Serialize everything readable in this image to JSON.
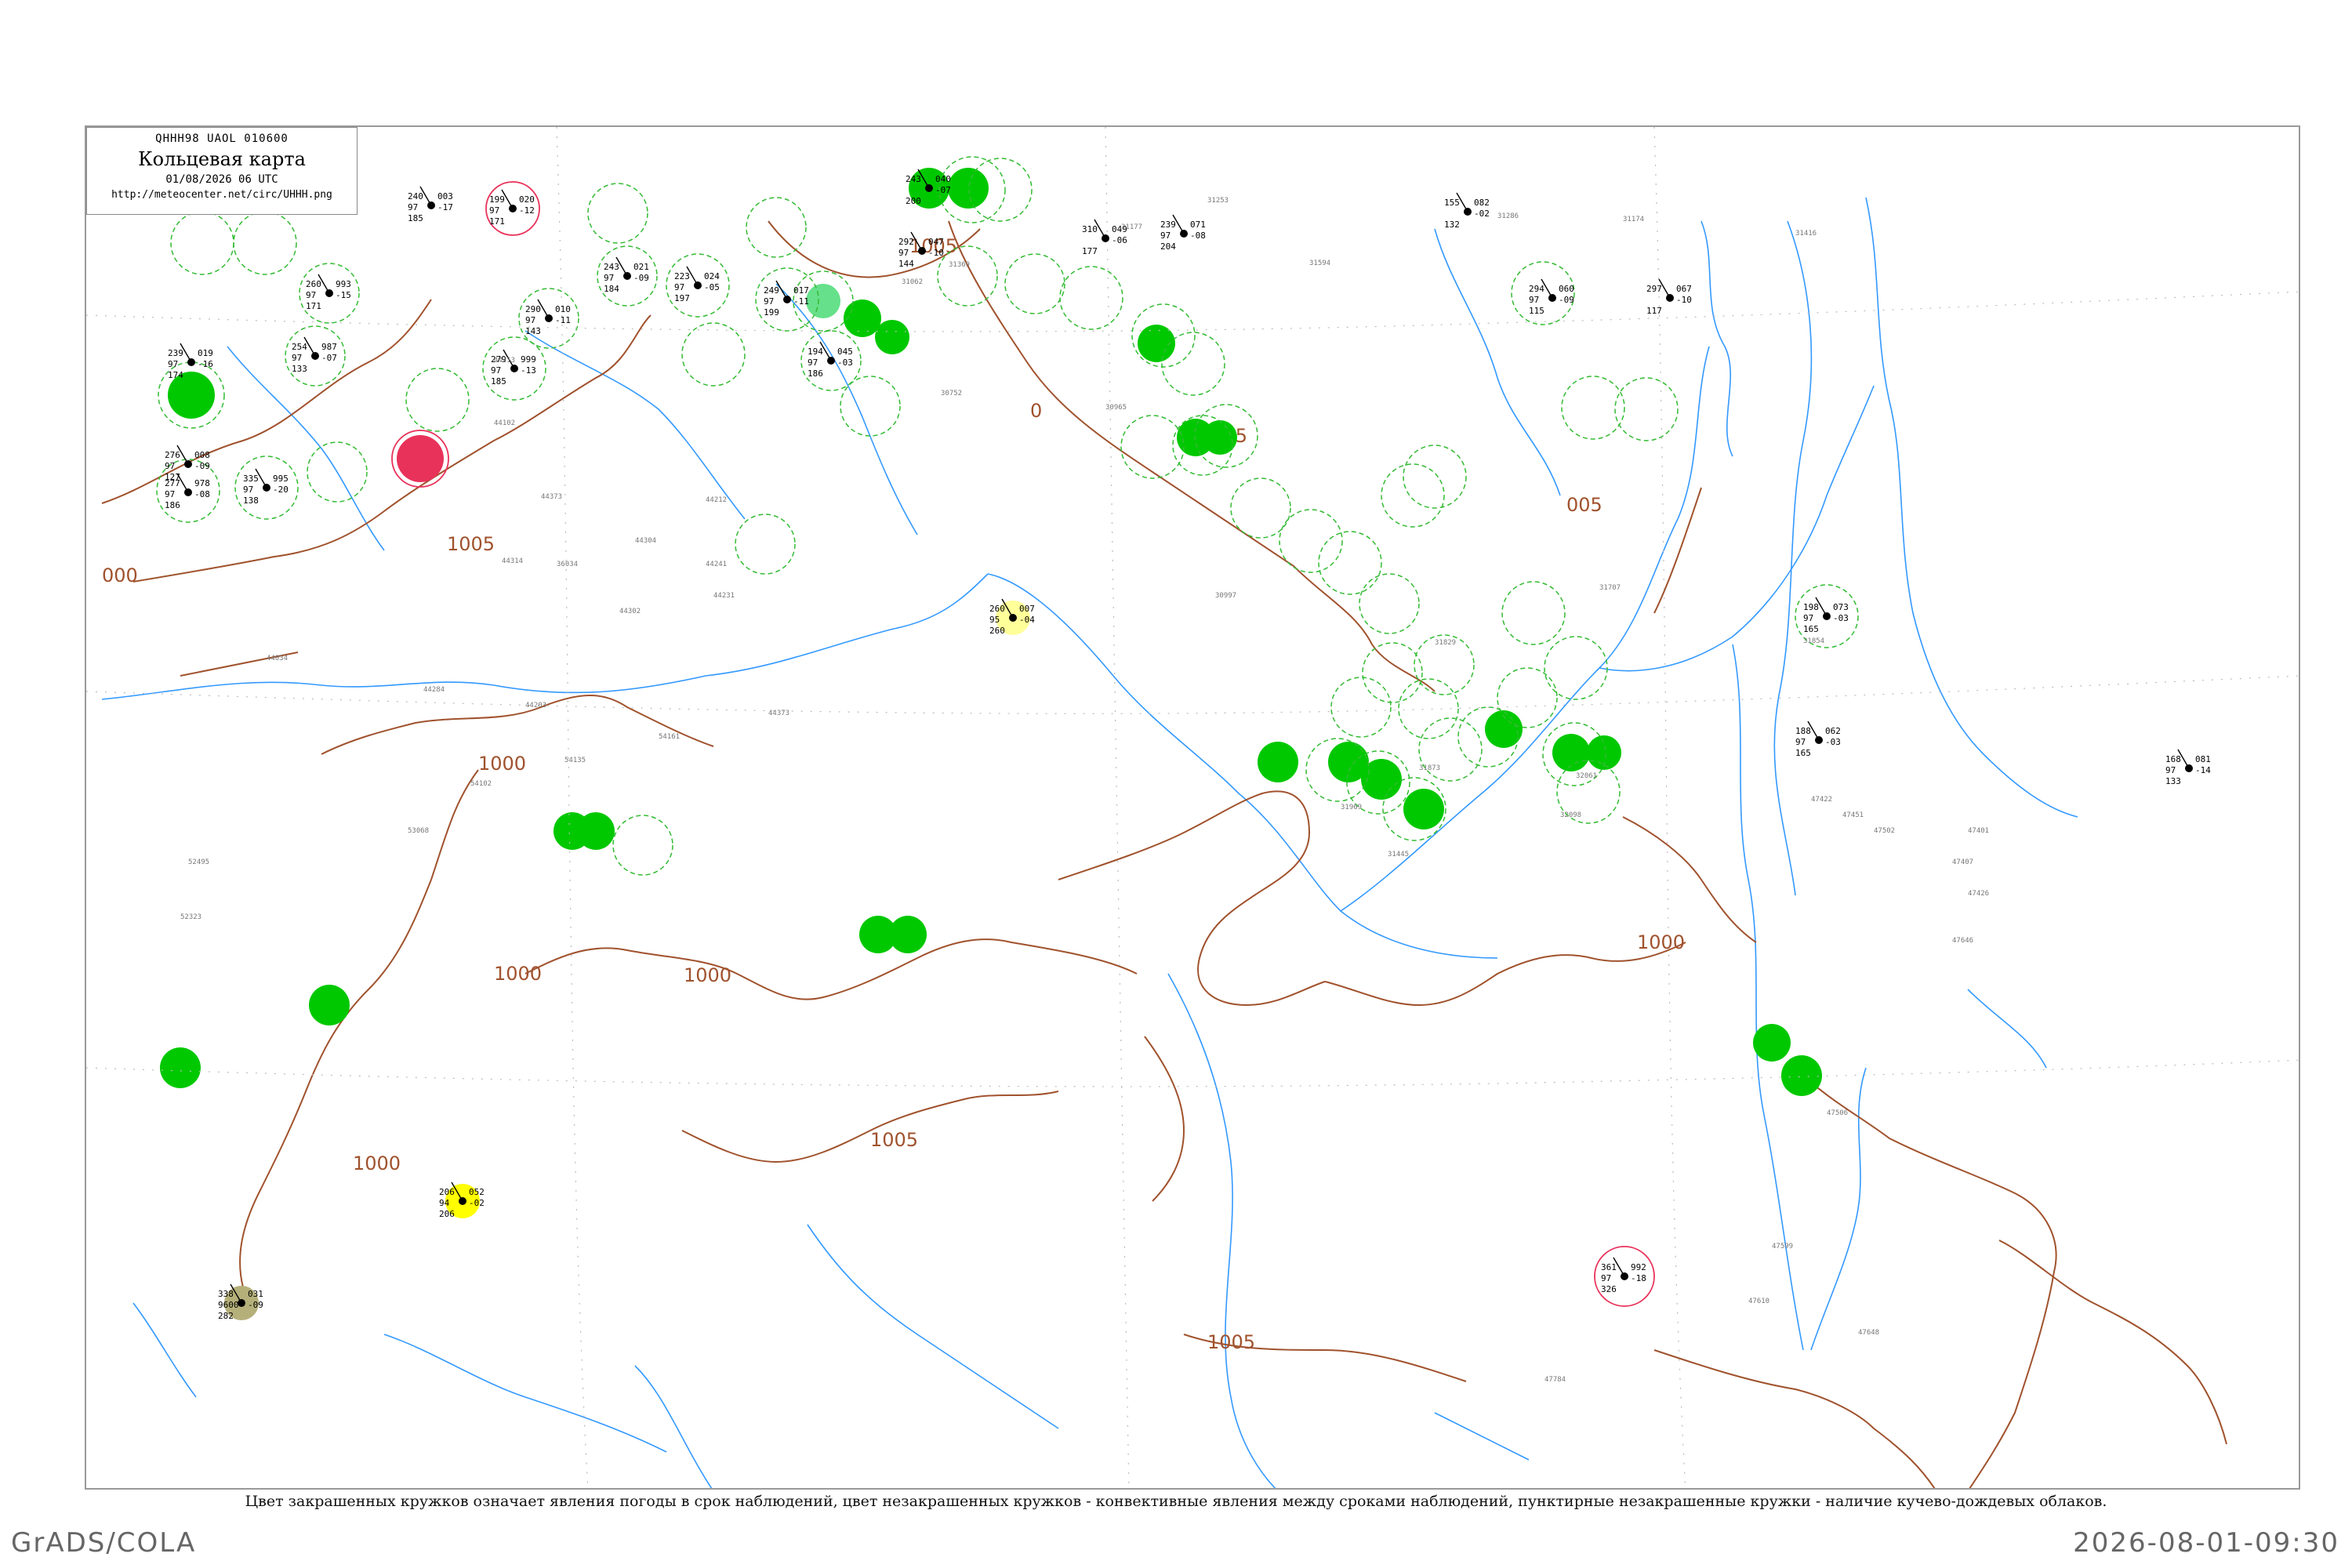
{
  "title_box": {
    "code_line": "QHHH98  UAOL  010600",
    "title": "Кольцевая карта",
    "datetime": "01/08/2026 06 UTC",
    "url": "http://meteocenter.net/circ/UHHH.png"
  },
  "footnote": "Цвет закрашенных кружков означает явления погоды в срок наблюдений, цвет незакрашенных кружков - конвективные явления между сроками наблюдений, пунктирные незакрашенные кружки - наличие кучево-дождевых облаков.",
  "footer_left": "GrADS/COLA",
  "footer_right": "2026-08-01-09:30",
  "colors": {
    "rain_green": "#00c800",
    "light_green": "#66e08a",
    "cb_dashed": "#33bb33",
    "thunder_red": "#e8325a",
    "yellow_pale": "#ffff99",
    "yellow": "#ffff00",
    "olive": "#b5b07a",
    "isobar": "#a0522d",
    "river": "#3399ff"
  },
  "isobar_labels": [
    "1005",
    "1005",
    "1000",
    "1000",
    "1000",
    "1000",
    "1005",
    "1005",
    "1005",
    "005",
    "0",
    "000",
    "1000"
  ],
  "stations": [
    {
      "id": "st01",
      "p": "239",
      "t": "97",
      "d": "174",
      "t2": "019",
      "d2": "-16",
      "idx": ""
    },
    {
      "id": "st02",
      "p": "276",
      "t": "97",
      "d": "127",
      "t2": "008",
      "d2": "-09",
      "idx": ""
    },
    {
      "id": "st03",
      "p": "277",
      "t": "97",
      "d": "186",
      "t2": "978",
      "d2": "-08",
      "idx": ""
    },
    {
      "id": "st04",
      "p": "335",
      "t": "97",
      "d": "138",
      "t2": "995",
      "d2": "-20",
      "idx": ""
    },
    {
      "id": "st05",
      "p": "254",
      "t": "97",
      "d": "133",
      "t2": "987",
      "d2": "-07",
      "idx": ""
    },
    {
      "id": "st06",
      "p": "260",
      "t": "97",
      "d": "171",
      "t2": "993",
      "d2": "-15",
      "idx": ""
    },
    {
      "id": "st07",
      "p": "240",
      "t": "97",
      "d": "185",
      "t2": "003",
      "d2": "-17",
      "idx": ""
    },
    {
      "id": "st08",
      "p": "199",
      "t": "97",
      "d": "171",
      "t2": "020",
      "d2": "-12",
      "idx": ""
    },
    {
      "id": "st09",
      "p": "290",
      "t": "97",
      "d": "143",
      "t2": "010",
      "d2": "-11",
      "idx": ""
    },
    {
      "id": "st10",
      "p": "279",
      "t": "97",
      "d": "185",
      "t2": "999",
      "d2": "-13",
      "idx": ""
    },
    {
      "id": "st11",
      "p": "243",
      "t": "97",
      "d": "184",
      "t2": "021",
      "d2": "-09",
      "idx": ""
    },
    {
      "id": "st12",
      "p": "223",
      "t": "97",
      "d": "197",
      "t2": "024",
      "d2": "-05",
      "idx": ""
    },
    {
      "id": "st13",
      "p": "249",
      "t": "97",
      "d": "199",
      "t2": "017",
      "d2": "-11",
      "idx": ""
    },
    {
      "id": "st14",
      "p": "194",
      "t": "97",
      "d": "186",
      "t2": "045",
      "d2": "-03",
      "idx": ""
    },
    {
      "id": "st15",
      "p": "243",
      "t": "",
      "d": "200",
      "t2": "040",
      "d2": "-07",
      "idx": ""
    },
    {
      "id": "st16",
      "p": "292",
      "t": "97",
      "d": "144",
      "t2": "047",
      "d2": "-10",
      "idx": ""
    },
    {
      "id": "st17",
      "p": "310",
      "t": "",
      "d": "177",
      "t2": "049",
      "d2": "-06",
      "idx": ""
    },
    {
      "id": "st18",
      "p": "239",
      "t": "97",
      "d": "204",
      "t2": "071",
      "d2": "-08",
      "idx": ""
    },
    {
      "id": "st19",
      "p": "155",
      "t": "",
      "d": "132",
      "t2": "082",
      "d2": "-02",
      "idx": ""
    },
    {
      "id": "st20",
      "p": "294",
      "t": "97",
      "d": "115",
      "t2": "060",
      "d2": "-09",
      "idx": ""
    },
    {
      "id": "st21",
      "p": "297",
      "t": "",
      "d": "117",
      "t2": "067",
      "d2": "-10",
      "idx": ""
    },
    {
      "id": "st22",
      "p": "260",
      "t": "95",
      "d": "260",
      "t2": "007",
      "d2": "-04",
      "idx": ""
    },
    {
      "id": "st23",
      "p": "206",
      "t": "94",
      "d": "206",
      "t2": "052",
      "d2": "-02",
      "idx": ""
    },
    {
      "id": "st24",
      "p": "338",
      "t": "9600",
      "d": "282",
      "t2": "031",
      "d2": "-09",
      "idx": ""
    },
    {
      "id": "st25",
      "p": "361",
      "t": "97",
      "d": "326",
      "t2": "992",
      "d2": "-18",
      "idx": ""
    },
    {
      "id": "st26",
      "p": "188",
      "t": "97",
      "d": "165",
      "t2": "062",
      "d2": "-03",
      "idx": ""
    },
    {
      "id": "st27",
      "p": "198",
      "t": "97",
      "d": "165",
      "t2": "073",
      "d2": "-03",
      "idx": ""
    },
    {
      "id": "st28",
      "p": "168",
      "t": "97",
      "d": "133",
      "t2": "081",
      "d2": "-14",
      "idx": ""
    }
  ],
  "station_indices": [
    "31253",
    "31286",
    "31174",
    "31416",
    "31369",
    "31062",
    "31177",
    "31594",
    "30752",
    "44212",
    "44373",
    "44304",
    "44314",
    "36034",
    "44241",
    "44231",
    "44302",
    "44213",
    "44102",
    "44034",
    "44203",
    "44284",
    "44373",
    "30965",
    "30997",
    "31707",
    "31829",
    "31854",
    "32061",
    "31873",
    "31969",
    "32098",
    "31445",
    "47422",
    "47451",
    "47502",
    "47506",
    "47599",
    "47610",
    "54161",
    "54135",
    "54102",
    "53068",
    "52495",
    "52323",
    "47401",
    "47407",
    "47426",
    "47646",
    "47648",
    "47784"
  ]
}
